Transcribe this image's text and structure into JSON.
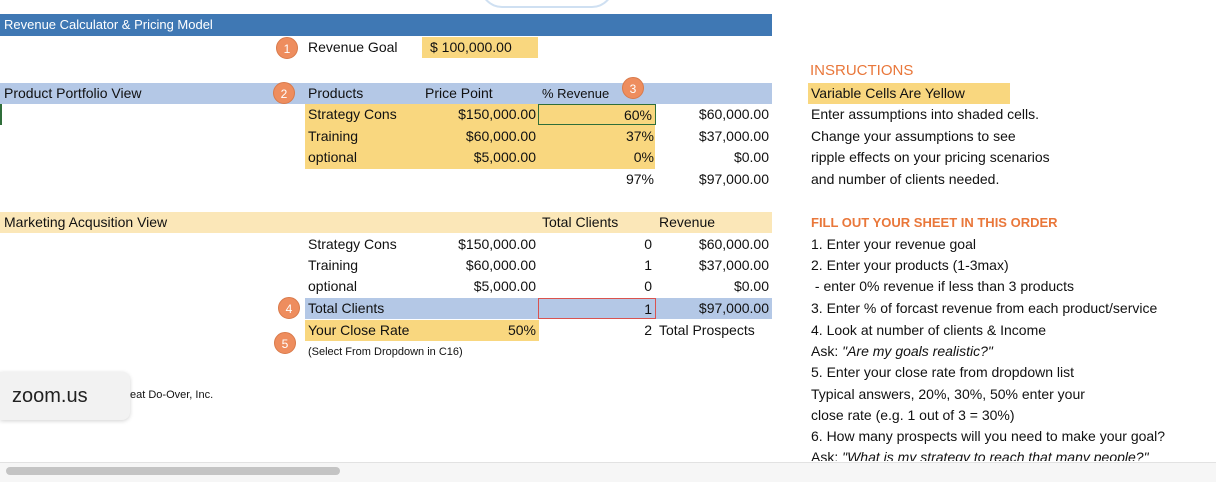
{
  "title_bar": {
    "title": "Revenue Calculator & Pricing Model"
  },
  "revenue_goal": {
    "label": "Revenue Goal",
    "value": "$  100,000.00"
  },
  "badges": [
    "1",
    "2",
    "3",
    "4",
    "5"
  ],
  "portfolio": {
    "section_label": "Product Portfolio View",
    "headers": {
      "products": "Products",
      "price": "Price Point",
      "pct": "% Revenue"
    },
    "rows": [
      {
        "name": "Strategy Cons",
        "price": "$150,000.00",
        "pct": "60%",
        "amount": "$60,000.00"
      },
      {
        "name": "Training",
        "price": "$60,000.00",
        "pct": "37%",
        "amount": "$37,000.00"
      },
      {
        "name": "optional",
        "price": "$5,000.00",
        "pct": "0%",
        "amount": "$0.00"
      }
    ],
    "total_pct": "97%",
    "total_amount": "$97,000.00"
  },
  "marketing": {
    "section_label": "Marketing Acqusition View",
    "headers": {
      "clients": "Total Clients",
      "revenue": "Revenue"
    },
    "rows": [
      {
        "name": "Strategy Cons",
        "price": "$150,000.00",
        "clients": "0",
        "revenue": "$60,000.00"
      },
      {
        "name": "Training",
        "price": "$60,000.00",
        "clients": "1",
        "revenue": "$37,000.00"
      },
      {
        "name": "optional",
        "price": "$5,000.00",
        "clients": "0",
        "revenue": "$0.00"
      }
    ],
    "total_label": "Total Clients",
    "total_clients": "1",
    "total_revenue": "$97,000.00",
    "close_rate_label": "Your Close Rate",
    "close_rate_value": "50%",
    "prospects_value": "2",
    "prospects_label": "Total Prospects",
    "dropdown_note": "(Select From Dropdown in C16)"
  },
  "footer_text": "eat Do-Over, Inc.",
  "zoom_label": "zoom.us",
  "instructions": {
    "heading": "INSRUCTIONS",
    "variable_note": "Variable Cells Are Yellow",
    "lines": [
      "Enter assumptions into shaded cells.",
      "Change your assumptions to see",
      "ripple effects on your pricing scenarios",
      "and number of clients needed."
    ],
    "order_heading": "FILL OUT YOUR SHEET IN THIS ORDER",
    "steps": [
      "1. Enter your revenue goal",
      "2. Enter your products (1-3max)",
      " - enter 0% revenue if less than 3 products",
      "3. Enter % of forcast revenue from each product/service",
      "4. Look at number of clients & Income",
      "5. Enter your close rate from dropdown list",
      "Typical answers, 20%, 30%, 50% enter your",
      "close rate (e.g. 1 out of 3 = 30%)",
      "6. How many prospects will you need to make your goal?"
    ],
    "ask1_prefix": "Ask: ",
    "ask1_quote": "\"Are my goals realistic?\"",
    "ask2_prefix": "Ask: ",
    "ask2_quote": "\"What is my strategy to reach that many people?\""
  },
  "colors": {
    "title_blue": "#3f78b4",
    "band_blue": "#b4c8e6",
    "yellow": "#f9d77f",
    "cream": "#fbe7b8",
    "badge_orange": "#ee8d5e",
    "heading_orange": "#e9773a"
  }
}
